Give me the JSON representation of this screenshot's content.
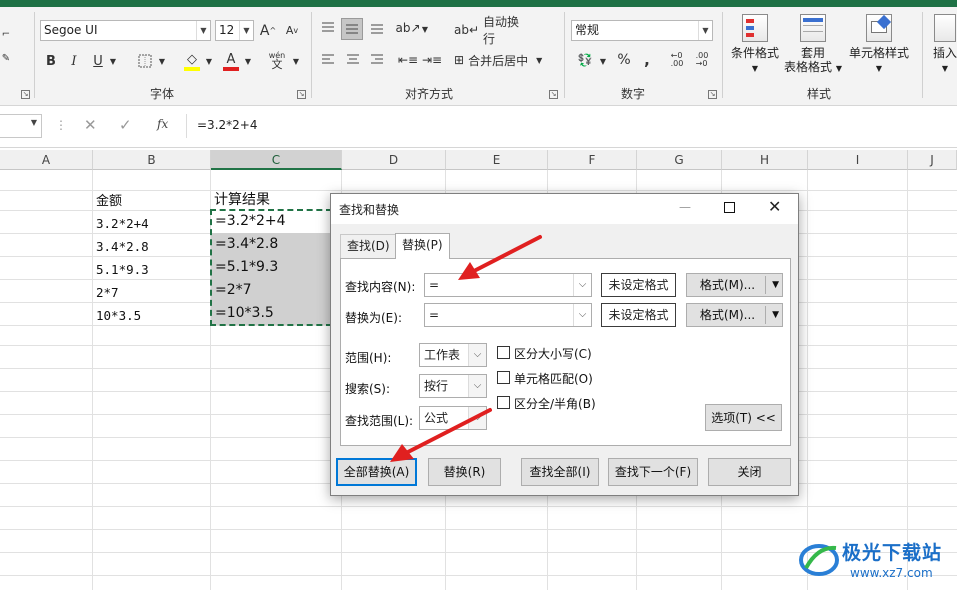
{
  "ribbon": {
    "font_name": "Segoe UI",
    "font_size": "12",
    "group_font": "字体",
    "group_align": "对齐方式",
    "group_number": "数字",
    "group_styles": "样式",
    "wrap_text": "自动换行",
    "merge_center": "合并后居中",
    "number_format": "常规",
    "conditional_format": "条件格式",
    "table_format_line1": "套用",
    "table_format_line2": "表格格式",
    "cell_styles": "单元格样式",
    "insert": "插入",
    "increase_font": "A",
    "decrease_font": "A",
    "bold": "B",
    "italic": "I",
    "underline": "U",
    "font_color": "A",
    "phonetic": "wén",
    "percent": "%",
    "comma": ",",
    "fx": "fx"
  },
  "colors": {
    "accent_green": "#1e7145",
    "arrow_red": "#e02020",
    "focus_blue": "#0078d7",
    "selection_gray": "#d0d0d0"
  },
  "formula_bar": {
    "content": "=3.2*2+4"
  },
  "columns": [
    "A",
    "B",
    "C",
    "D",
    "E",
    "F",
    "G",
    "H",
    "I",
    "J"
  ],
  "cells": {
    "b_header": "金额",
    "c_header": "计算结果",
    "b_values": [
      "3.2*2+4",
      "3.4*2.8",
      "5.1*9.3",
      "2*7",
      "10*3.5"
    ],
    "c_values": [
      "=3.2*2+4",
      "=3.4*2.8",
      "=5.1*9.3",
      "=2*7",
      "=10*3.5"
    ]
  },
  "dialog": {
    "title": "查找和替换",
    "tab_find": "查找(D)",
    "tab_replace": "替换(P)",
    "find_label": "查找内容(N):",
    "find_value": "=",
    "replace_label": "替换为(E):",
    "replace_value": "=",
    "no_format_1": "未设定格式",
    "no_format_2": "未设定格式",
    "format_btn_1": "格式(M)...",
    "format_btn_2": "格式(M)...",
    "within_label": "范围(H):",
    "within_value": "工作表",
    "search_label": "搜索(S):",
    "search_value": "按行",
    "lookin_label": "查找范围(L):",
    "lookin_value": "公式",
    "match_case": "区分大小写(C)",
    "match_entire": "单元格匹配(O)",
    "match_byte": "区分全/半角(B)",
    "options_btn": "选项(T) <<",
    "replace_all": "全部替换(A)",
    "replace": "替换(R)",
    "find_all": "查找全部(I)",
    "find_next": "查找下一个(F)",
    "close": "关闭"
  },
  "watermark": {
    "brand": "极光下载站",
    "url": "www.xz7.com"
  }
}
